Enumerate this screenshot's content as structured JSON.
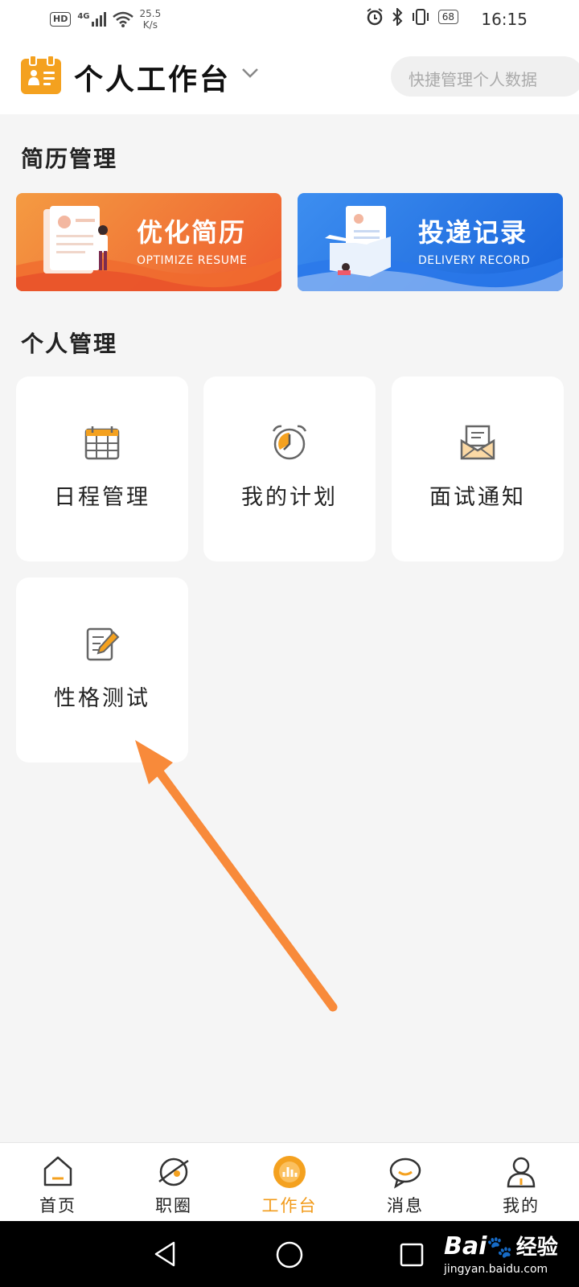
{
  "status_bar": {
    "hd": "HD",
    "network": "4G",
    "speed_value": "25.5",
    "speed_unit": "K/s",
    "battery": "68",
    "time": "16:15"
  },
  "header": {
    "title": "个人工作台",
    "search_placeholder": "快捷管理个人数据"
  },
  "sections": {
    "resume": "简历管理",
    "personal": "个人管理"
  },
  "banners": [
    {
      "title": "优化简历",
      "subtitle": "OPTIMIZE RESUME",
      "color": "#ee5c2f"
    },
    {
      "title": "投递记录",
      "subtitle": "DELIVERY RECORD",
      "color": "#1964da"
    }
  ],
  "cards": [
    {
      "label": "日程管理",
      "icon": "calendar-icon"
    },
    {
      "label": "我的计划",
      "icon": "alarm-clock-icon"
    },
    {
      "label": "面试通知",
      "icon": "envelope-icon"
    },
    {
      "label": "性格测试",
      "icon": "edit-note-icon"
    }
  ],
  "tabs": [
    {
      "label": "首页",
      "icon": "home-icon"
    },
    {
      "label": "职圈",
      "icon": "planet-icon"
    },
    {
      "label": "工作台",
      "icon": "workbench-icon",
      "active": true
    },
    {
      "label": "消息",
      "icon": "chat-bubble-icon"
    },
    {
      "label": "我的",
      "icon": "user-icon"
    }
  ],
  "colors": {
    "accent": "#f29b1b",
    "arrow": "#f88a3a"
  },
  "watermark": {
    "brand": "Bai",
    "brand_cn": "经验",
    "url": "jingyan.baidu.com"
  }
}
